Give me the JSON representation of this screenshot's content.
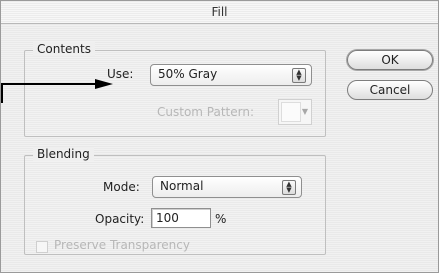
{
  "dialog": {
    "title": "Fill"
  },
  "contents": {
    "group_title": "Contents",
    "use_label": "Use:",
    "use_value": "50% Gray",
    "custom_pattern_label": "Custom Pattern:"
  },
  "buttons": {
    "ok": "OK",
    "cancel": "Cancel"
  },
  "blending": {
    "group_title": "Blending",
    "mode_label": "Mode:",
    "mode_value": "Normal",
    "opacity_label": "Opacity:",
    "opacity_value": "100",
    "opacity_unit": "%",
    "preserve_label": "Preserve Transparency"
  },
  "icons": {
    "stepper": "stepper-icon",
    "dropdown": "chevron-down-icon",
    "callout": "callout-arrow-icon"
  }
}
